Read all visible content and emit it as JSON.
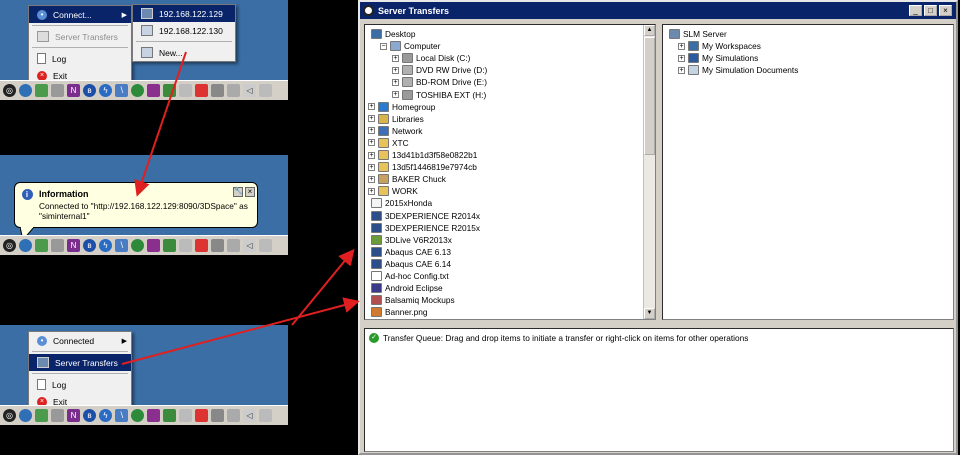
{
  "panel1": {
    "menu": {
      "connect": "Connect...",
      "server_transfers": "Server Transfers",
      "log": "Log",
      "exit": "Exit"
    },
    "submenu": {
      "ip1": "192.168.122.129",
      "ip2": "192.168.122.130",
      "new": "New..."
    }
  },
  "panel2": {
    "balloon": {
      "title": "Information",
      "line1": "Connected to \"http://192.168.122.129:8090/3DSpace\" as",
      "line2": "\"siminternal1\""
    }
  },
  "panel3": {
    "menu": {
      "connected": "Connected",
      "server_transfers": "Server Transfers",
      "log": "Log",
      "exit": "Exit"
    }
  },
  "window": {
    "title": "Server Transfers",
    "buttons": {
      "minimize": "_",
      "maximize": "□",
      "close": "×"
    },
    "left_tree": [
      {
        "label": "Desktop",
        "indent": 0,
        "exp": "",
        "icon": "desktop"
      },
      {
        "label": "Computer",
        "indent": 1,
        "exp": "−",
        "icon": "computer"
      },
      {
        "label": "Local Disk (C:)",
        "indent": 2,
        "exp": "+",
        "icon": "drive"
      },
      {
        "label": "DVD RW Drive (D:)",
        "indent": 2,
        "exp": "+",
        "icon": "dvd"
      },
      {
        "label": "BD-ROM Drive (E:)",
        "indent": 2,
        "exp": "+",
        "icon": "dvd"
      },
      {
        "label": "TOSHIBA EXT (H:)",
        "indent": 2,
        "exp": "+",
        "icon": "drive"
      },
      {
        "label": "Homegroup",
        "indent": 0,
        "exp": "+",
        "icon": "homegroup"
      },
      {
        "label": "Libraries",
        "indent": 0,
        "exp": "+",
        "icon": "library"
      },
      {
        "label": "Network",
        "indent": 0,
        "exp": "+",
        "icon": "network"
      },
      {
        "label": "XTC",
        "indent": 0,
        "exp": "+",
        "icon": "folder"
      },
      {
        "label": "13d41b1d3f58e0822b1",
        "indent": 0,
        "exp": "+",
        "icon": "folder"
      },
      {
        "label": "13d5f1446819e7974cb",
        "indent": 0,
        "exp": "+",
        "icon": "folder"
      },
      {
        "label": "BAKER Chuck",
        "indent": 0,
        "exp": "+",
        "icon": "user"
      },
      {
        "label": "WORK",
        "indent": 0,
        "exp": "+",
        "icon": "folder"
      },
      {
        "label": "2015xHonda",
        "indent": 0,
        "exp": "",
        "icon": "file"
      },
      {
        "label": "3DEXPERIENCE R2014x",
        "indent": 0,
        "exp": "",
        "icon": "app"
      },
      {
        "label": "3DEXPERIENCE R2015x",
        "indent": 0,
        "exp": "",
        "icon": "app"
      },
      {
        "label": "3DLive V6R2013x",
        "indent": 0,
        "exp": "",
        "icon": "app2"
      },
      {
        "label": "Abaqus CAE 6.13",
        "indent": 0,
        "exp": "",
        "icon": "app"
      },
      {
        "label": "Abaqus CAE 6.14",
        "indent": 0,
        "exp": "",
        "icon": "app"
      },
      {
        "label": "Ad-hoc Config.txt",
        "indent": 0,
        "exp": "",
        "icon": "text"
      },
      {
        "label": "Android Eclipse",
        "indent": 0,
        "exp": "",
        "icon": "eclipse"
      },
      {
        "label": "Balsamiq Mockups",
        "indent": 0,
        "exp": "",
        "icon": "balsamiq"
      },
      {
        "label": "Banner.png",
        "indent": 0,
        "exp": "",
        "icon": "image"
      }
    ],
    "right_tree": [
      {
        "label": "SLM Server",
        "indent": 0,
        "exp": "",
        "icon": "server"
      },
      {
        "label": "My Workspaces",
        "indent": 1,
        "exp": "+",
        "icon": "workspace"
      },
      {
        "label": "My Simulations",
        "indent": 1,
        "exp": "+",
        "icon": "simulation"
      },
      {
        "label": "My Simulation Documents",
        "indent": 1,
        "exp": "+",
        "icon": "documents"
      }
    ],
    "transfer_queue": "Transfer Queue: Drag and drop items to initiate a transfer or right-click on items for other operations"
  },
  "colors": {
    "highlight": "#0a246a",
    "arrow": "#e02020",
    "desktop": "#3a6ea5",
    "balloon": "#ffffe1"
  }
}
